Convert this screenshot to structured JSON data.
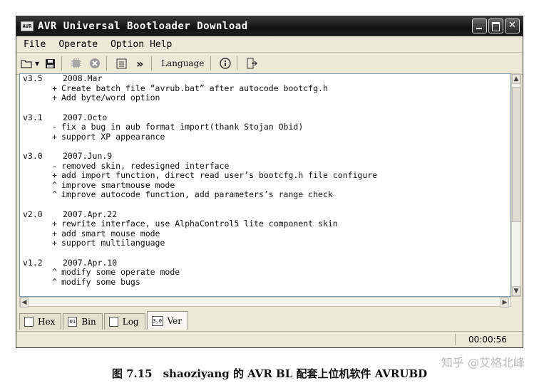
{
  "window": {
    "title": "AVR Universal Bootloader Download",
    "app_icon": "AVR"
  },
  "menu": [
    "File",
    "Operate",
    "Option",
    "Help"
  ],
  "toolbar": {
    "language_label": "Language"
  },
  "log": [
    {
      "version": "v3.5",
      "date": "2008.Mar",
      "lines": [
        {
          "m": "+",
          "t": "Create batch file “avrub.bat” after autocode bootcfg.h"
        },
        {
          "m": "+",
          "t": "Add byte/word option"
        }
      ]
    },
    {
      "version": "v3.1",
      "date": "2007.Octo",
      "lines": [
        {
          "m": "-",
          "t": "fix a bug in aub format import(thank Stojan Obid)"
        },
        {
          "m": "+",
          "t": "support XP appearance"
        }
      ]
    },
    {
      "version": "v3.0",
      "date": "2007.Jun.9",
      "lines": [
        {
          "m": "-",
          "t": "removed skin, redesigned interface"
        },
        {
          "m": "+",
          "t": "add import function, direct read user’s bootcfg.h file configure"
        },
        {
          "m": "^",
          "t": "improve smartmouse mode"
        },
        {
          "m": "^",
          "t": "improve autocode function, add parameters’s range check"
        }
      ]
    },
    {
      "version": "v2.0",
      "date": "2007.Apr.22",
      "lines": [
        {
          "m": "+",
          "t": "rewrite interface, use AlphaControl5 lite component skin"
        },
        {
          "m": "+",
          "t": "add smart mouse mode"
        },
        {
          "m": "+",
          "t": "support multilanguage"
        }
      ]
    },
    {
      "version": "v1.2",
      "date": "2007.Apr.10",
      "lines": [
        {
          "m": "^",
          "t": "modify some operate mode"
        },
        {
          "m": "^",
          "t": "modify some bugs"
        }
      ]
    }
  ],
  "tabs": [
    {
      "label": "Hex",
      "icon": ""
    },
    {
      "label": "Bin",
      "icon": "01"
    },
    {
      "label": "Log",
      "icon": ""
    },
    {
      "label": "Ver",
      "icon": "3.0"
    }
  ],
  "status": {
    "time": "00:00:56"
  },
  "caption": "图 7.15　shaoziyang 的 AVR BL 配套上位机软件 AVRUBD",
  "watermark": "知乎 @艾格北峰"
}
